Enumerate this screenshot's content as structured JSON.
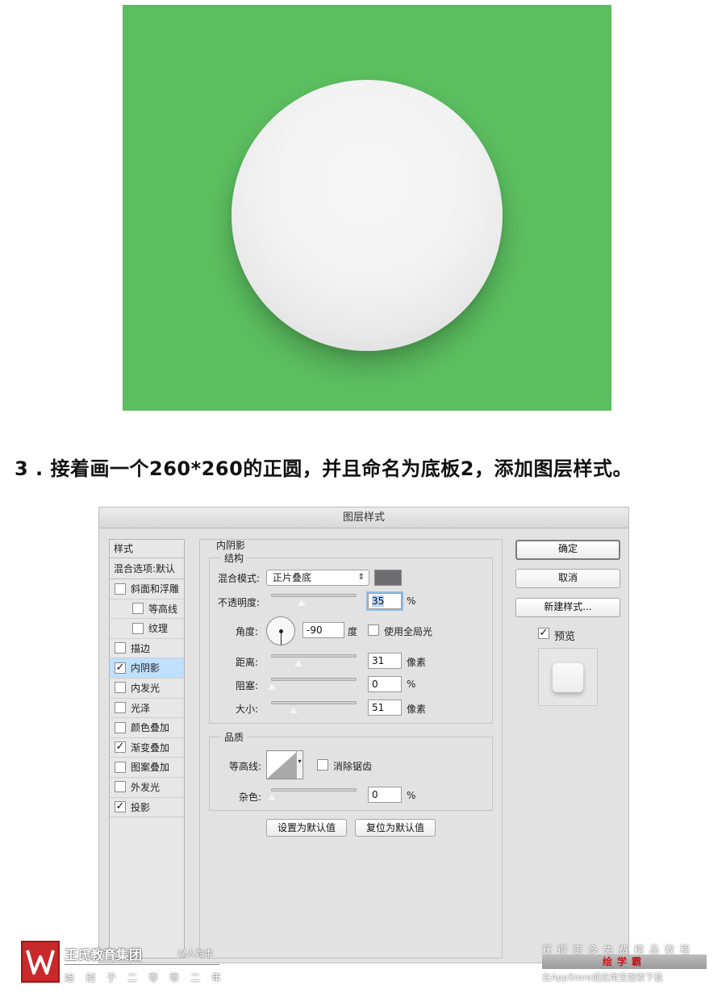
{
  "step_heading": "3 . 接着画一个260*260的正圆，并且命名为底板2，添加图层样式。",
  "dialog": {
    "title": "图层样式",
    "style_list": {
      "header": "样式",
      "blend_options": "混合选项:默认",
      "items": [
        {
          "label": "斜面和浮雕",
          "checked": false
        },
        {
          "label": "等高线",
          "checked": false
        },
        {
          "label": "纹理",
          "checked": false
        },
        {
          "label": "描边",
          "checked": false
        },
        {
          "label": "内阴影",
          "checked": true,
          "selected": true
        },
        {
          "label": "内发光",
          "checked": false
        },
        {
          "label": "光泽",
          "checked": false
        },
        {
          "label": "颜色叠加",
          "checked": false
        },
        {
          "label": "渐变叠加",
          "checked": true
        },
        {
          "label": "图案叠加",
          "checked": false
        },
        {
          "label": "外发光",
          "checked": false
        },
        {
          "label": "投影",
          "checked": true
        }
      ]
    },
    "inner_shadow": {
      "section_title": "内阴影",
      "structure_title": "结构",
      "blend_mode_label": "混合模式:",
      "blend_mode_value": "正片叠底",
      "shadow_color": "#6e6e70",
      "opacity_label": "不透明度:",
      "opacity_value": "35",
      "percent": "%",
      "angle_label": "角度:",
      "angle_value": "-90",
      "degree_unit": "度",
      "global_light_label": "使用全局光",
      "distance_label": "距离:",
      "distance_value": "31",
      "pixel_unit": "像素",
      "choke_label": "阻塞:",
      "choke_value": "0",
      "size_label": "大小:",
      "size_value": "51",
      "quality_title": "品质",
      "contour_label": "等高线:",
      "antialias_label": "消除锯齿",
      "noise_label": "杂色:",
      "noise_value": "0",
      "make_default": "设置为默认值",
      "reset_default": "复位为默认值"
    },
    "buttons": {
      "ok": "确定",
      "cancel": "取消",
      "new_style": "新建样式...",
      "preview_label": "预览"
    }
  },
  "footer": {
    "left_title": "王氏教育集团",
    "left_slogan": "以人为本",
    "left_bottom": "始创于二零零二年",
    "right_top": "获得更多免费精品教程",
    "right_brand": "绘学霸",
    "right_bottom": "在AppStore或应用宝搜索下载"
  },
  "colors": {
    "canvas_green": "#5bbe5f",
    "selection_blue": "#bfe0ff"
  }
}
